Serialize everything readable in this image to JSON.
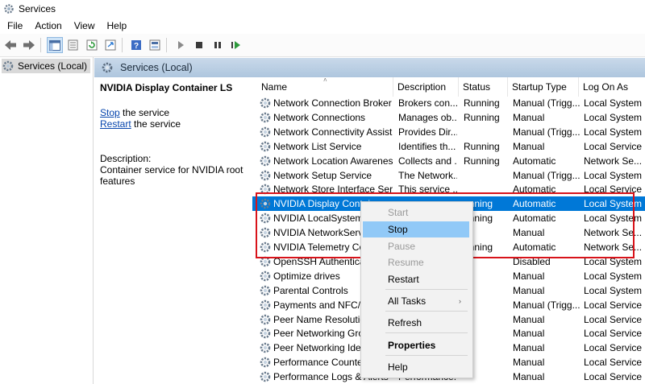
{
  "window": {
    "title": "Services"
  },
  "menu": [
    "File",
    "Action",
    "View",
    "Help"
  ],
  "toolbar": {
    "buttons": [
      "back-icon",
      "forward-icon",
      "show-hide-tree-icon",
      "properties-icon",
      "refresh-icon",
      "export-list-icon",
      "help-icon",
      "console-tree-icon",
      "start-service-icon",
      "stop-service-icon",
      "pause-service-icon",
      "restart-service-icon"
    ]
  },
  "tree": {
    "root_label": "Services (Local)"
  },
  "main": {
    "header": "Services (Local)"
  },
  "details": {
    "title": "NVIDIA Display Container LS",
    "stop_link": "Stop",
    "stop_suffix": " the service",
    "restart_link": "Restart",
    "restart_suffix": " the service",
    "desc_label": "Description:",
    "desc_line1": "Container service for NVIDIA root",
    "desc_line2": "features"
  },
  "columns": [
    "Name",
    "Description",
    "Status",
    "Startup Type",
    "Log On As"
  ],
  "rows": [
    [
      "Network Connection Broker",
      "Brokers con...",
      "Running",
      "Manual (Trigg...",
      "Local System"
    ],
    [
      "Network Connections",
      "Manages ob...",
      "Running",
      "Manual",
      "Local System"
    ],
    [
      "Network Connectivity Assist...",
      "Provides Dir...",
      "",
      "Manual (Trigg...",
      "Local System"
    ],
    [
      "Network List Service",
      "Identifies th...",
      "Running",
      "Manual",
      "Local Service"
    ],
    [
      "Network Location Awareness",
      "Collects and ...",
      "Running",
      "Automatic",
      "Network Se..."
    ],
    [
      "Network Setup Service",
      "The Network...",
      "",
      "Manual (Trigg...",
      "Local System"
    ],
    [
      "Network Store Interface Serv...",
      "This service ...",
      "",
      "Automatic",
      "Local Service"
    ],
    [
      "NVIDIA Display Contai",
      "",
      "unning",
      "Automatic",
      "Local System"
    ],
    [
      "NVIDIA LocalSystem Co",
      "",
      "unning",
      "Automatic",
      "Local System"
    ],
    [
      "NVIDIA NetworkServic",
      "",
      "",
      "Manual",
      "Network Se..."
    ],
    [
      "NVIDIA Telemetry Con",
      "",
      "unning",
      "Automatic",
      "Network Se..."
    ],
    [
      "OpenSSH Authenticatio",
      "",
      "",
      "Disabled",
      "Local System"
    ],
    [
      "Optimize drives",
      "",
      "",
      "Manual",
      "Local System"
    ],
    [
      "Parental Controls",
      "",
      "",
      "Manual",
      "Local System"
    ],
    [
      "Payments and NFC/SE",
      "",
      "",
      "Manual (Trigg...",
      "Local Service"
    ],
    [
      "Peer Name Resolution",
      "",
      "",
      "Manual",
      "Local Service"
    ],
    [
      "Peer Networking Grou",
      "",
      "",
      "Manual",
      "Local Service"
    ],
    [
      "Peer Networking Ident",
      "",
      "",
      "Manual",
      "Local Service"
    ],
    [
      "Performance Counter I",
      "",
      "",
      "Manual",
      "Local Service"
    ],
    [
      "Performance Logs & Alerts",
      "Performance...",
      "",
      "Manual",
      "Local Service"
    ]
  ],
  "context_menu": {
    "start": "Start",
    "stop": "Stop",
    "pause": "Pause",
    "resume": "Resume",
    "restart": "Restart",
    "all_tasks": "All Tasks",
    "refresh": "Refresh",
    "properties": "Properties",
    "help": "Help"
  },
  "colors": {
    "selection": "#0078d7",
    "highlight_box": "#d8131a",
    "menu_hover": "#91c9f7",
    "link": "#0645ad"
  }
}
